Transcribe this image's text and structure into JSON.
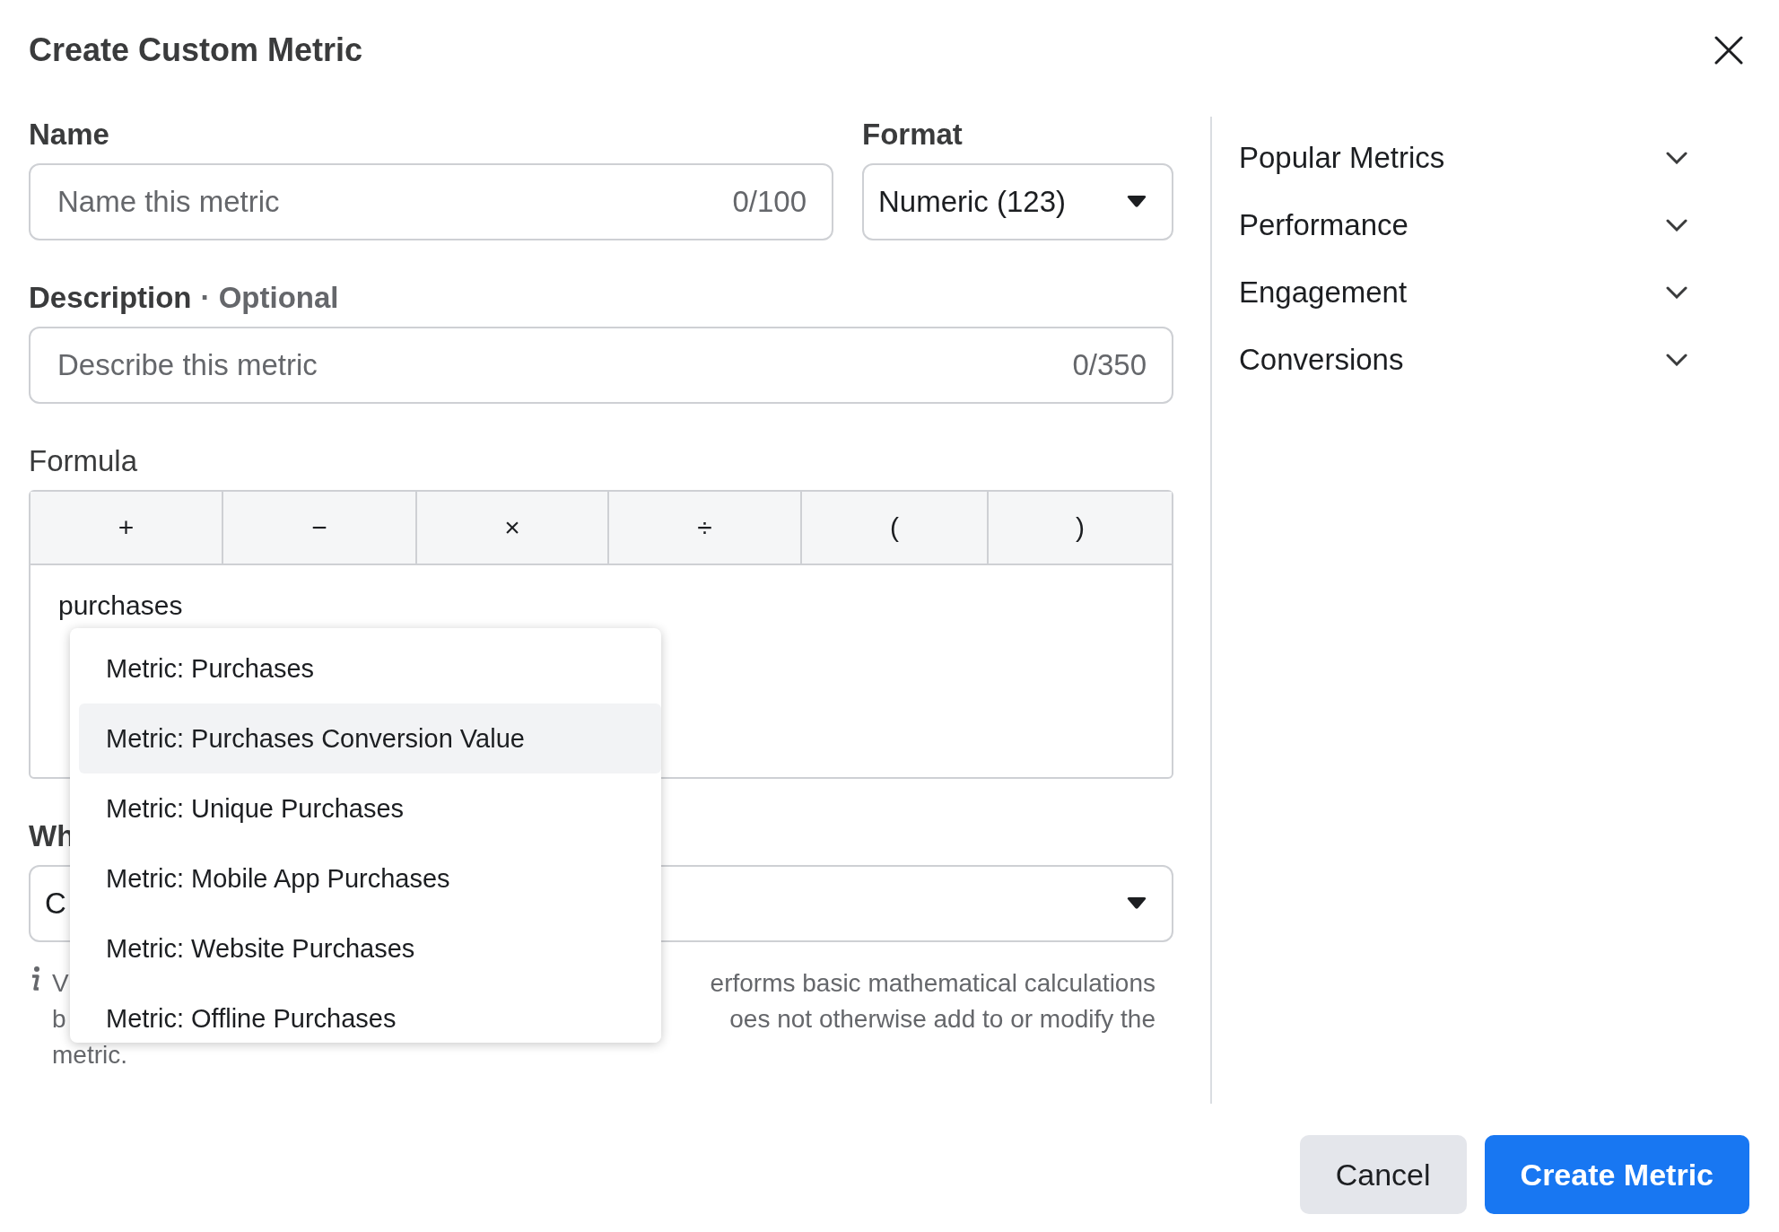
{
  "dialog": {
    "title": "Create Custom Metric"
  },
  "name_field": {
    "label": "Name",
    "placeholder": "Name this metric",
    "counter": "0/100"
  },
  "format_field": {
    "label": "Format",
    "value": "Numeric (123)"
  },
  "description_field": {
    "label": "Description",
    "optional": "· Optional",
    "placeholder": "Describe this metric",
    "counter": "0/350"
  },
  "formula": {
    "label": "Formula",
    "operators": [
      "+",
      "−",
      "×",
      "÷",
      "(",
      ")"
    ],
    "value": "purchases"
  },
  "suggestions": [
    {
      "label": "Metric: Purchases",
      "selected": false
    },
    {
      "label": "Metric: Purchases Conversion Value",
      "selected": true
    },
    {
      "label": "Metric: Unique Purchases",
      "selected": false
    },
    {
      "label": "Metric: Mobile App Purchases",
      "selected": false
    },
    {
      "label": "Metric: Website Purchases",
      "selected": false
    },
    {
      "label": "Metric: Offline Purchases",
      "selected": false
    }
  ],
  "partial_field": {
    "label": "Wh",
    "value": "C"
  },
  "info": {
    "lines": [
      {
        "left": "V",
        "right": "erforms basic mathematical calculations"
      },
      {
        "left": "b",
        "right": "oes not otherwise add to or modify the"
      },
      {
        "left": "metric."
      }
    ]
  },
  "sections": [
    {
      "label": "Popular Metrics",
      "expanded": false
    },
    {
      "label": "Performance",
      "expanded": false
    },
    {
      "label": "Engagement",
      "expanded": false
    },
    {
      "label": "Conversions",
      "expanded": false
    }
  ],
  "buttons": {
    "cancel": "Cancel",
    "create": "Create Metric"
  }
}
